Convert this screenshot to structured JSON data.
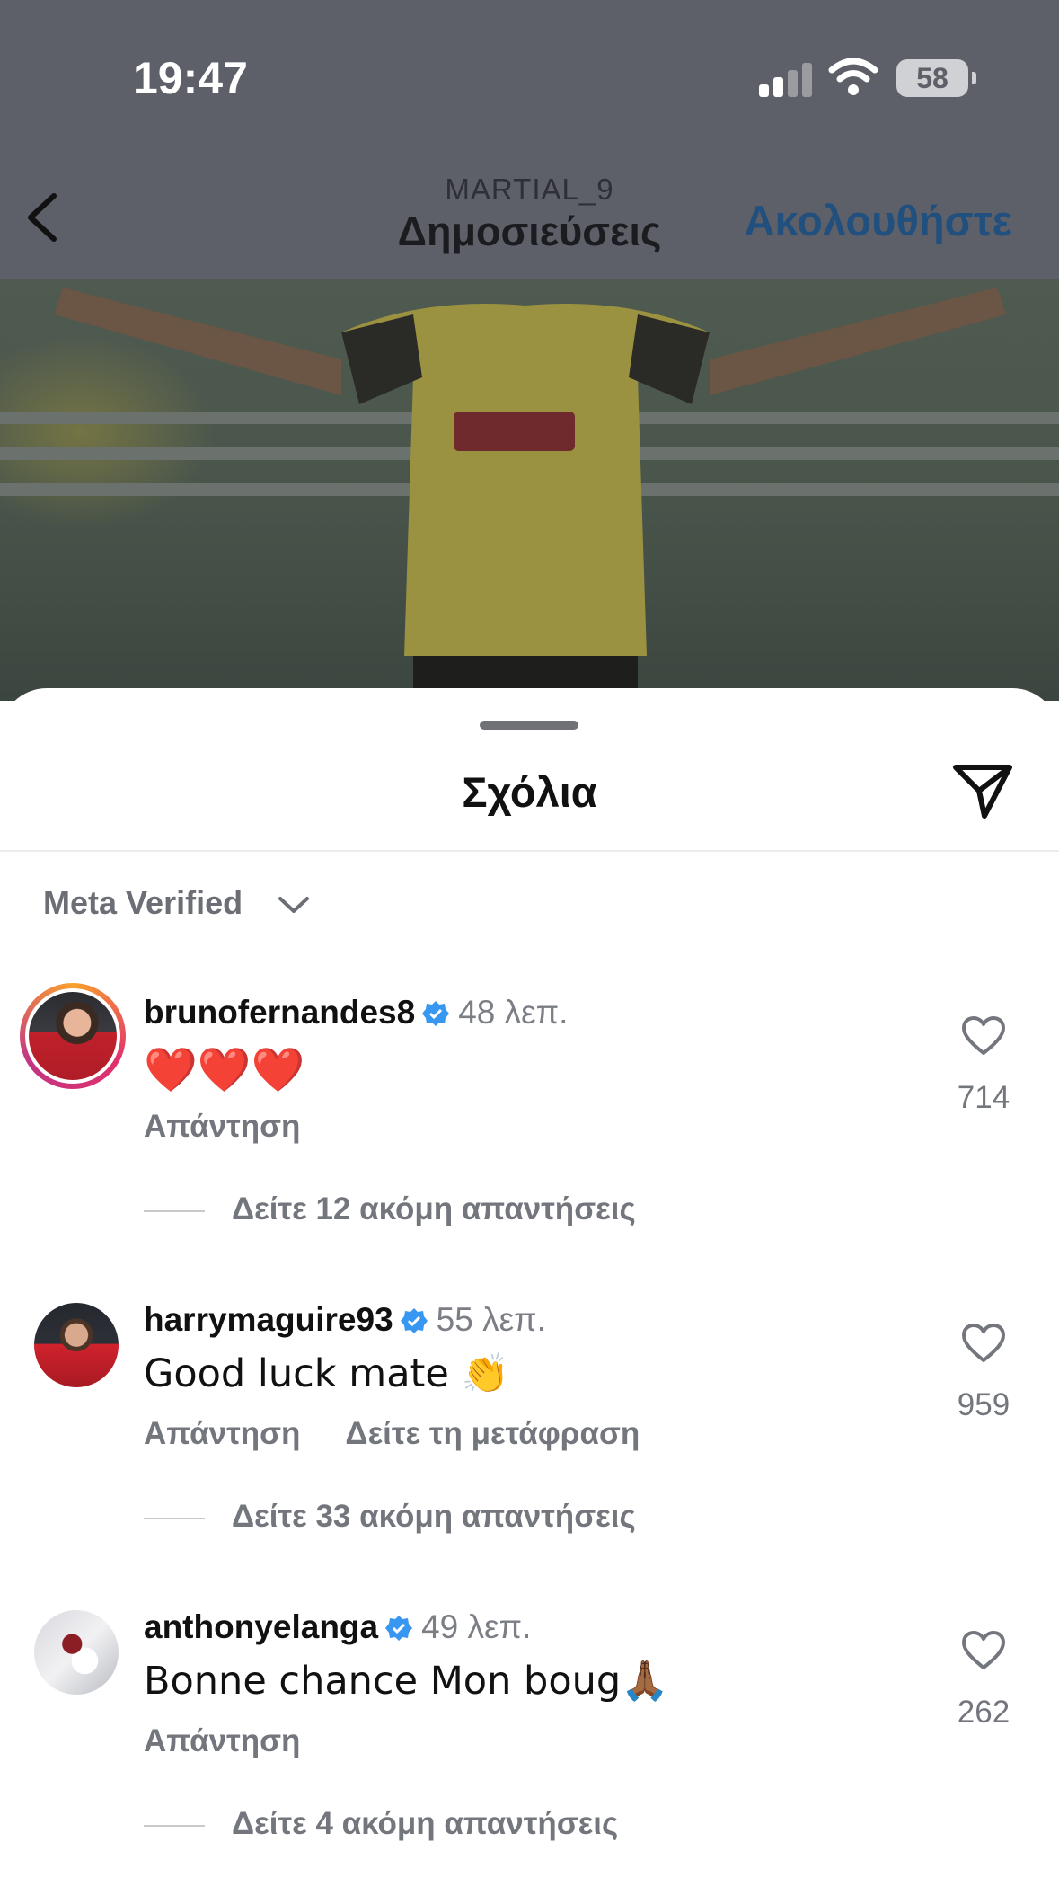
{
  "status_bar": {
    "time": "19:47",
    "battery": "58"
  },
  "nav": {
    "username": "MARTIAL_9",
    "title": "Δημοσιεύσεις",
    "follow_label": "Ακολουθήστε"
  },
  "sheet": {
    "title": "Σχόλια",
    "filter_label": "Meta Verified"
  },
  "comments": [
    {
      "username": "brunofernandes8",
      "time": "48 λεπ.",
      "text": "❤️❤️❤️",
      "actions": [
        "Απάντηση"
      ],
      "likes": "714",
      "view_replies": "Δείτε 12 ακόμη απαντήσεις"
    },
    {
      "username": "harrymaguire93",
      "time": "55 λεπ.",
      "text": "Good luck mate 👏",
      "actions": [
        "Απάντηση",
        "Δείτε τη μετάφραση"
      ],
      "likes": "959",
      "view_replies": "Δείτε 33 ακόμη απαντήσεις"
    },
    {
      "username": "anthonyelanga",
      "time": "49 λεπ.",
      "text": "Bonne chance Mon boug🙏🏾",
      "actions": [
        "Απάντηση"
      ],
      "likes": "262",
      "view_replies": "Δείτε 4 ακόμη απαντήσεις"
    }
  ],
  "colors": {
    "dim_overlay": "#5d6068",
    "follow": "#22507e",
    "verified": "#3897f0"
  }
}
